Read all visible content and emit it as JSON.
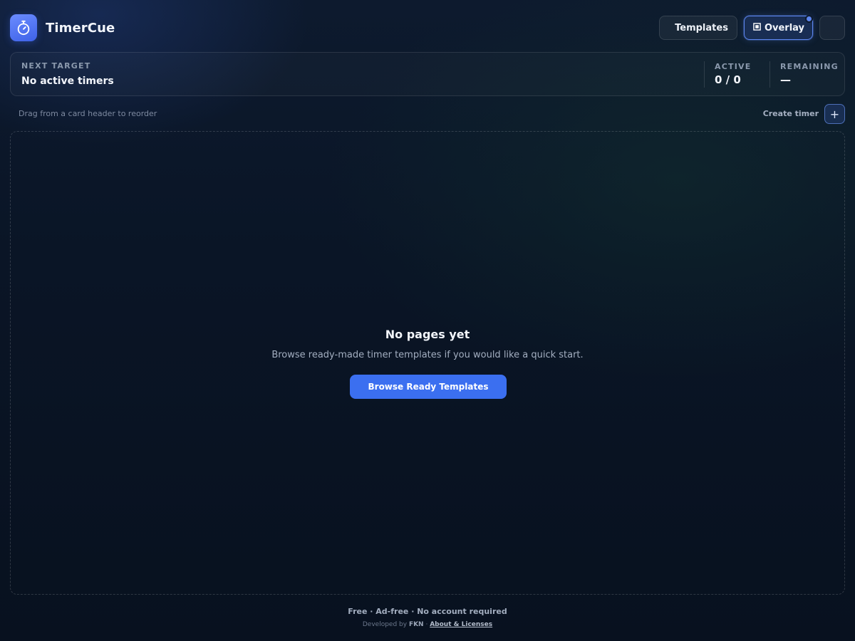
{
  "app": {
    "name": "TimerCue",
    "logo_icon": "stopwatch-icon",
    "accent_color": "#3b6ff0"
  },
  "header": {
    "templates_label": "Templates",
    "overlay_label": "Overlay",
    "overlay_icon": "overlay-square-icon",
    "overlay_active": true
  },
  "status": {
    "next_target_label": "NEXT TARGET",
    "next_target_value": "No active timers",
    "active_label": "ACTIVE",
    "active_value": "0 / 0",
    "remaining_label": "REMAINING",
    "remaining_value": "—"
  },
  "toolbar": {
    "hint": "Drag from a card header to reorder",
    "create_label": "Create timer",
    "add_symbol": "+"
  },
  "empty_state": {
    "title": "No pages yet",
    "description": "Browse ready-made timer templates if you would like a quick start.",
    "button_label": "Browse Ready Templates"
  },
  "footer": {
    "tagline": "Free · Ad-free · No account required",
    "developed_by_prefix": "Developed by",
    "developer": "FKN",
    "separator": "·",
    "about_link": "About & Licenses"
  }
}
